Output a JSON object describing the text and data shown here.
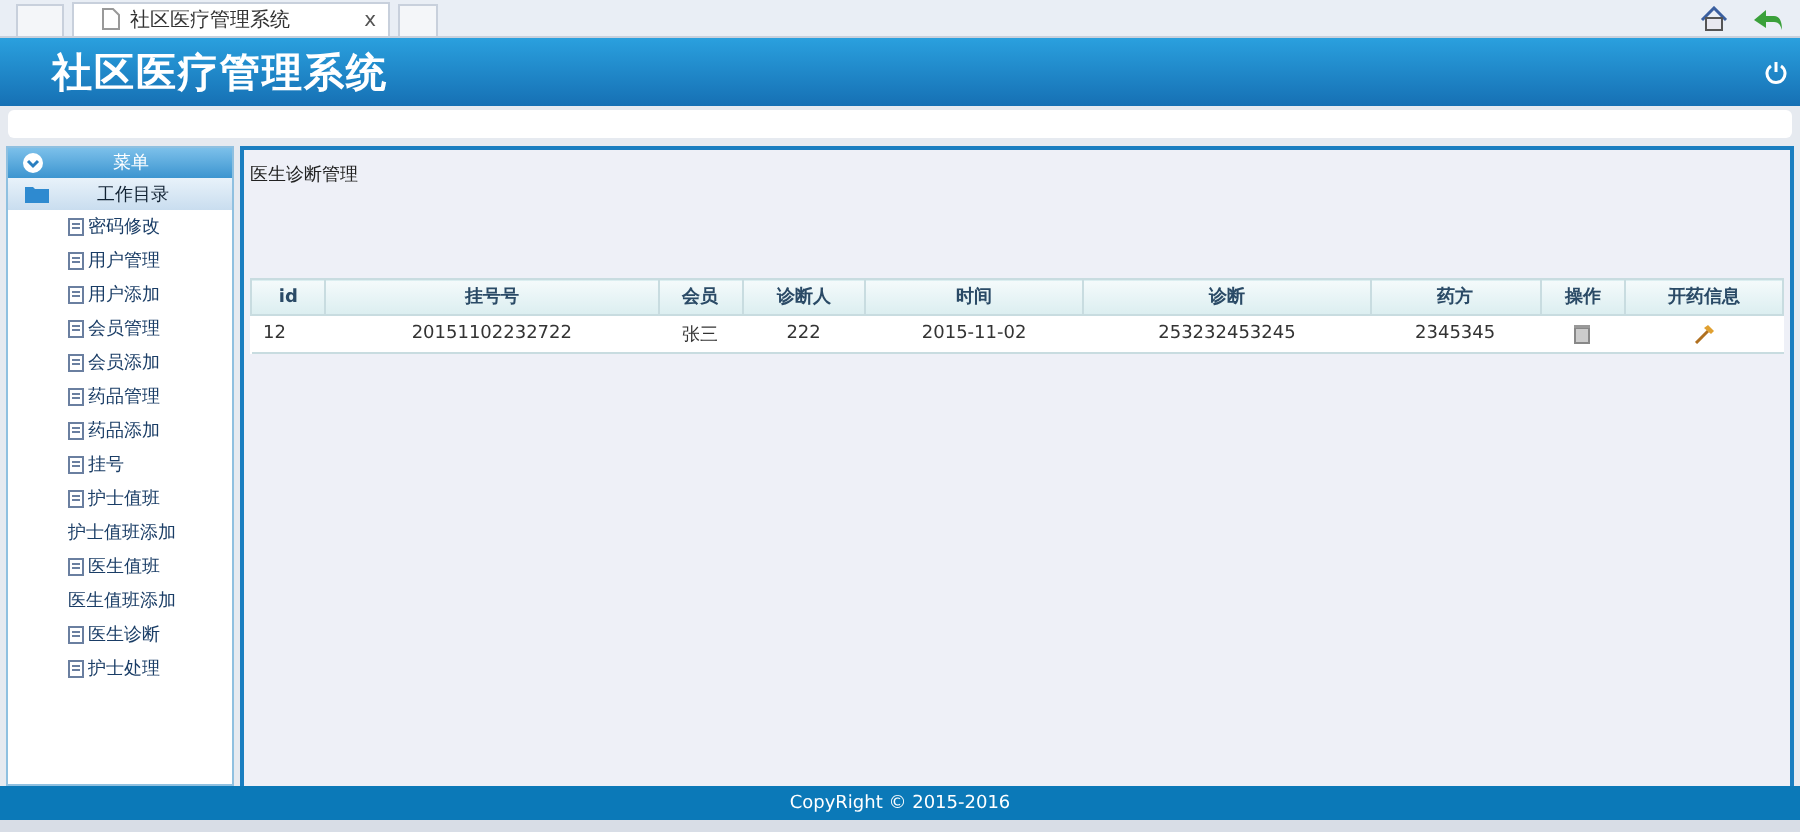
{
  "browser": {
    "tab_title": "社区医疗管理系统",
    "tab_close": "x"
  },
  "header": {
    "title": "社区医疗管理系统"
  },
  "sidebar": {
    "menu_label": "菜单",
    "folder": "工作目录",
    "items": [
      {
        "label": "密码修改",
        "icon": true
      },
      {
        "label": "用户管理",
        "icon": true
      },
      {
        "label": "用户添加",
        "icon": true
      },
      {
        "label": "会员管理",
        "icon": true
      },
      {
        "label": "会员添加",
        "icon": true
      },
      {
        "label": "药品管理",
        "icon": true
      },
      {
        "label": "药品添加",
        "icon": true
      },
      {
        "label": "挂号",
        "icon": true
      },
      {
        "label": "护士值班",
        "icon": true
      },
      {
        "label": "护士值班添加",
        "icon": false
      },
      {
        "label": "医生值班",
        "icon": true
      },
      {
        "label": "医生值班添加",
        "icon": false
      },
      {
        "label": "医生诊断",
        "icon": true
      },
      {
        "label": "护士处理",
        "icon": true
      }
    ]
  },
  "content": {
    "title": "医生诊断管理",
    "table": {
      "columns": [
        "id",
        "挂号号",
        "会员",
        "诊断人",
        "时间",
        "诊断",
        "药方",
        "操作",
        "开药信息"
      ],
      "rows": [
        {
          "cells": [
            "12",
            "20151102232722",
            "张三",
            "222",
            "2015-11-02",
            "253232453245",
            "2345345"
          ]
        }
      ]
    }
  },
  "footer": {
    "text": "CopyRight © 2015-2016"
  }
}
